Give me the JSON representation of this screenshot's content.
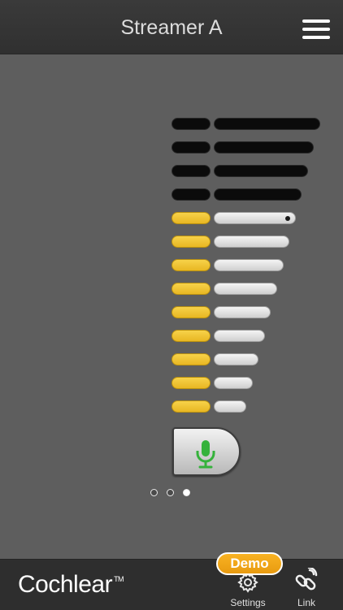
{
  "header": {
    "title": "Streamer A",
    "menu_icon": "hamburger-menu-icon"
  },
  "volume_control": {
    "total_levels": 13,
    "current_level": 9,
    "active_color": "#f0c83a",
    "inactive_color": "#0b0b0b",
    "bar_color": "#e4e4e4"
  },
  "mic_button": {
    "icon": "microphone-icon",
    "icon_color": "#35b23b"
  },
  "pager": {
    "count": 3,
    "selected_index": 2
  },
  "footer": {
    "logo_text": "Cochlear",
    "logo_tm": "TM",
    "demo_badge": "Demo",
    "settings_label": "Settings",
    "link_label": "Link"
  }
}
